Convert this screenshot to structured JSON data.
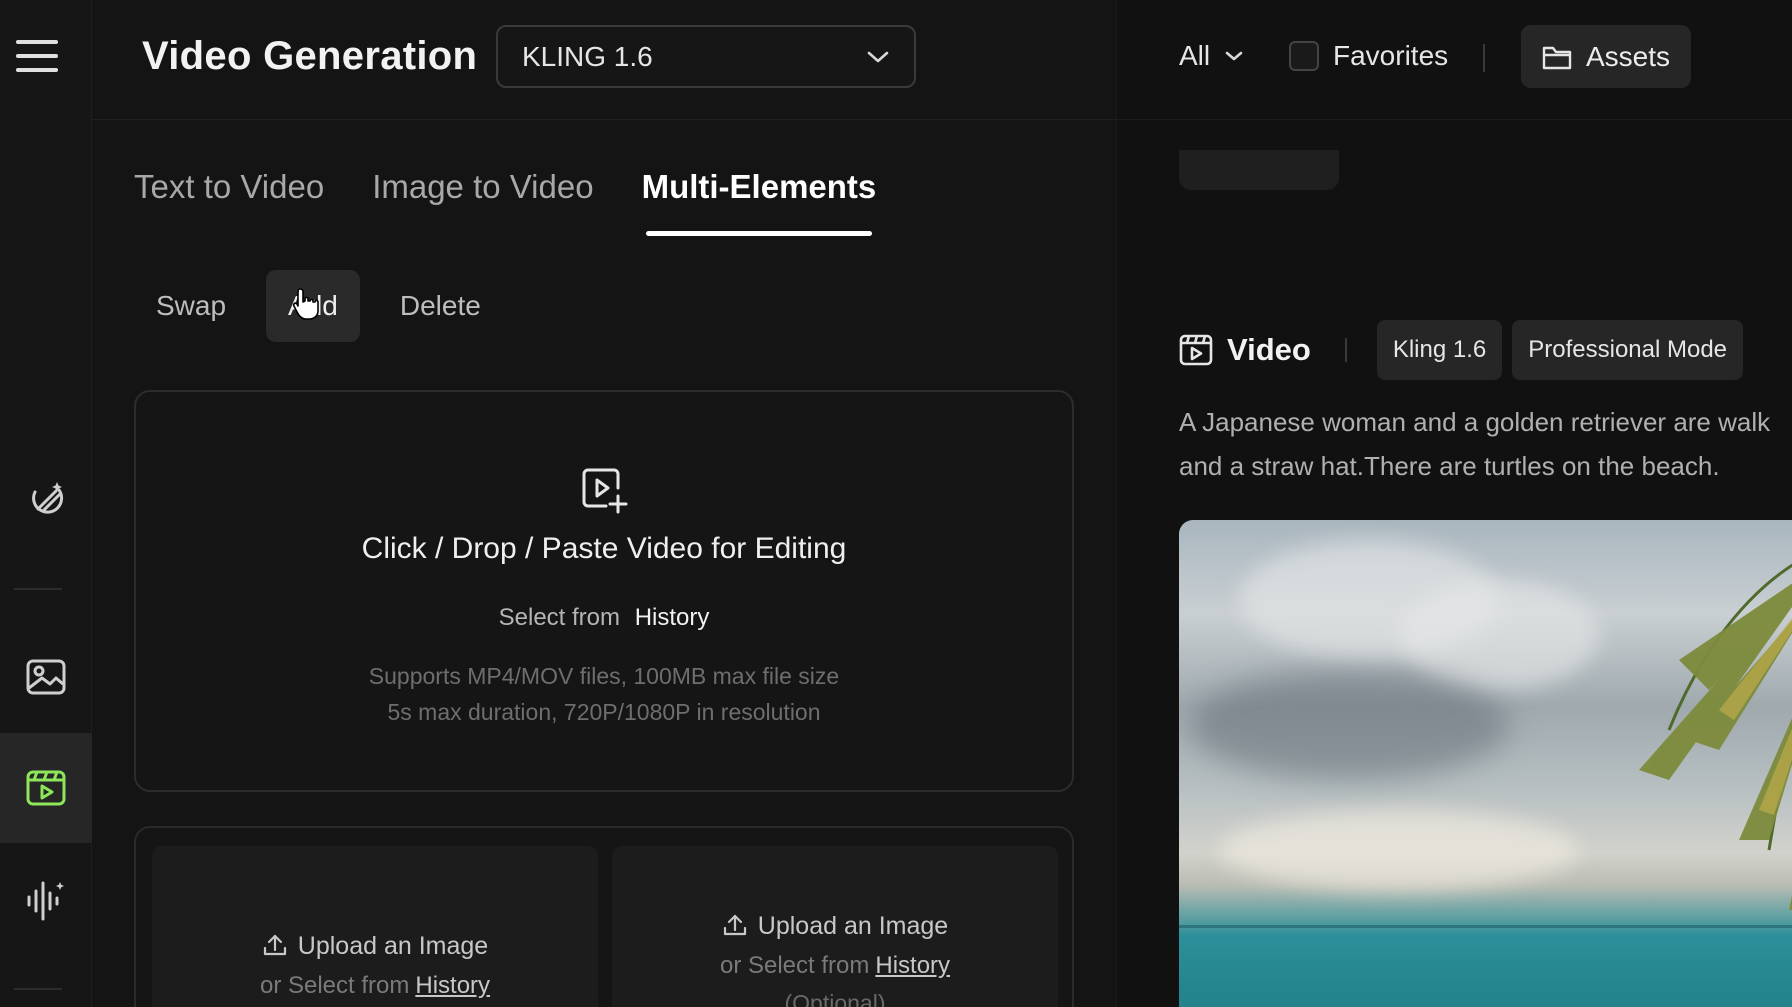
{
  "header": {
    "title": "Video Generation",
    "model": "KLING 1.6"
  },
  "tabs": [
    {
      "label": "Text to Video"
    },
    {
      "label": "Image to Video"
    },
    {
      "label": "Multi-Elements",
      "active": true
    }
  ],
  "subtabs": [
    {
      "label": "Swap"
    },
    {
      "label": "Add",
      "active": true
    },
    {
      "label": "Delete"
    }
  ],
  "upload": {
    "title": "Click / Drop / Paste Video for Editing",
    "select_prefix": "Select from",
    "history": "History",
    "support_line1": "Supports MP4/MOV files, 100MB max file size",
    "support_line2": "5s max duration, 720P/1080P in resolution"
  },
  "elements": [
    {
      "upload_label": "Upload an Image",
      "or_select": "or Select from",
      "history": "History"
    },
    {
      "upload_label": "Upload an Image",
      "or_select": "or Select from",
      "history": "History",
      "optional": "(Optional)"
    }
  ],
  "right": {
    "filter": "All",
    "favorites": "Favorites",
    "assets": "Assets",
    "video_label": "Video",
    "tags": [
      "Kling 1.6",
      "Professional Mode"
    ],
    "prompt_line1": "A Japanese woman and a golden retriever are walk",
    "prompt_line2": "and a straw hat.There are turtles on the beach."
  },
  "colors": {
    "background": "#141414",
    "active_icon": "#8ee65a",
    "text": "#e8e8e8"
  },
  "icons": [
    "menu-icon",
    "effects-icon",
    "image-icon",
    "video-icon",
    "audio-icon",
    "chevron-down-icon",
    "video-add-icon",
    "upload-icon",
    "folder-icon",
    "video-clip-icon"
  ]
}
